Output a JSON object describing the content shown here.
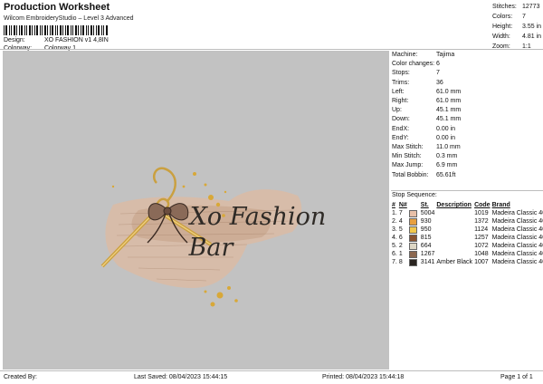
{
  "header": {
    "title": "Production Worksheet",
    "software": "Wilcom EmbroideryStudio – Level 3 Advanced"
  },
  "meta": {
    "design_label": "Design:",
    "design_value": "XO FASHION v1 4,8IN",
    "colorway_label": "Colorway:",
    "colorway_value": "Colorway 1"
  },
  "stats": {
    "stitches_label": "Stitches:",
    "stitches_value": "12773",
    "colors_label": "Colors:",
    "colors_value": "7",
    "height_label": "Height:",
    "height_value": "3.55 in",
    "width_label": "Width:",
    "width_value": "4.81 in",
    "zoom_label": "Zoom:",
    "zoom_value": "1:1"
  },
  "design_text": {
    "line1": "Xo Fashion",
    "line2": "Bar"
  },
  "machine_info": [
    {
      "label": "Machine:",
      "value": "Tajima"
    },
    {
      "label": "Color changes:",
      "value": "6"
    },
    {
      "label": "Stops:",
      "value": "7"
    },
    {
      "label": "Trims:",
      "value": "36"
    },
    {
      "label": "Left:",
      "value": "61.0 mm"
    },
    {
      "label": "Right:",
      "value": "61.0 mm"
    },
    {
      "label": "Up:",
      "value": "45.1 mm"
    },
    {
      "label": "Down:",
      "value": "45.1 mm"
    },
    {
      "label": "EndX:",
      "value": "0.00 in"
    },
    {
      "label": "EndY:",
      "value": "0.00 in"
    },
    {
      "label": "Max Stitch:",
      "value": "11.0 mm"
    },
    {
      "label": "Min Stitch:",
      "value": "0.3 mm"
    },
    {
      "label": "Max Jump:",
      "value": "6.9 mm"
    },
    {
      "label": "Total Bobbin:",
      "value": "65.61ft"
    }
  ],
  "stop_sequence": {
    "title": "Stop Sequence:",
    "headers": [
      "#",
      "N#",
      "",
      "St.",
      "Description",
      "Code",
      "Brand"
    ],
    "rows": [
      {
        "num": "1.",
        "n": "7",
        "color": "#e8c0a8",
        "st": "5004",
        "desc": "",
        "code": "1019",
        "brand": "Madeira Classic 40"
      },
      {
        "num": "2.",
        "n": "4",
        "color": "#e8a040",
        "st": "930",
        "desc": "",
        "code": "1372",
        "brand": "Madeira Classic 40"
      },
      {
        "num": "3.",
        "n": "5",
        "color": "#f2c84c",
        "st": "950",
        "desc": "",
        "code": "1124",
        "brand": "Madeira Classic 40"
      },
      {
        "num": "4.",
        "n": "6",
        "color": "#8a5430",
        "st": "815",
        "desc": "",
        "code": "1257",
        "brand": "Madeira Classic 40"
      },
      {
        "num": "5.",
        "n": "2",
        "color": "#ddd6c4",
        "st": "664",
        "desc": "",
        "code": "1072",
        "brand": "Madeira Classic 40"
      },
      {
        "num": "6.",
        "n": "1",
        "color": "#8c6850",
        "st": "1267",
        "desc": "",
        "code": "1048",
        "brand": "Madeira Classic 40"
      },
      {
        "num": "7.",
        "n": "8",
        "color": "#2a2420",
        "st": "3141",
        "desc": "Amber Black",
        "code": "1007",
        "brand": "Madeira Classic 40"
      }
    ]
  },
  "footer": {
    "created_by": "Created By:",
    "last_saved": "Last Saved: 08/04/2023 15:44:15",
    "printed": "Printed: 08/04/2023 15:44:18",
    "page": "Page 1 of 1"
  }
}
